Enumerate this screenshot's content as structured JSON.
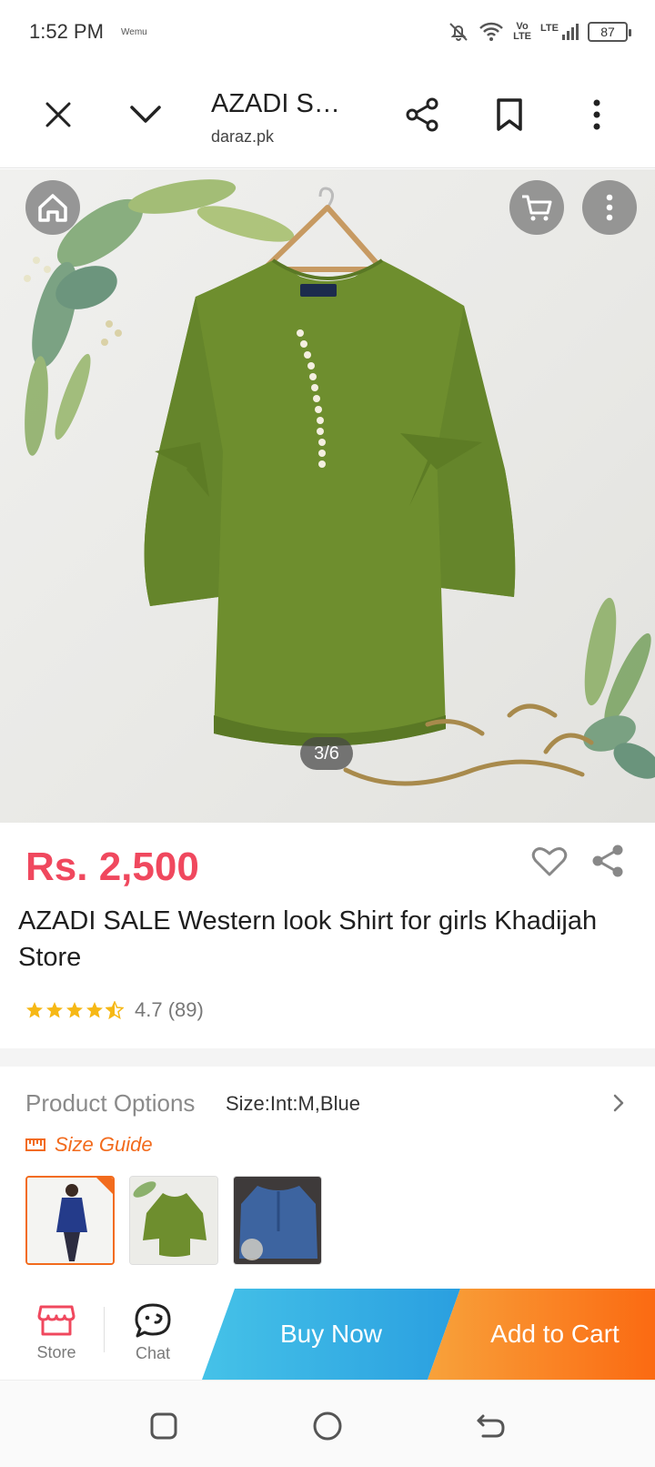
{
  "status_bar": {
    "time": "1:52 PM",
    "small_label": "Wemu",
    "volte": "Vo\nLTE",
    "lte": "LTE",
    "battery": "87"
  },
  "toolbar": {
    "title": "AZADI SALE Western look Shirt for girls Khadijah Store",
    "url": "daraz.pk",
    "icons": [
      "close-icon",
      "chevron-down-icon",
      "share-icon",
      "bookmark-icon",
      "more-vert-icon"
    ]
  },
  "gallery": {
    "counter": "3/6",
    "current": 3,
    "total": 6,
    "icons": [
      "home-icon",
      "cart-icon",
      "more-vert-icon"
    ]
  },
  "product": {
    "price": "Rs. 2,500",
    "title": "AZADI SALE Western look Shirt for girls Khadijah Store",
    "rating_value": 4.7,
    "rating_text": "4.7 (89)",
    "price_color": "#f0485e"
  },
  "options": {
    "label": "Product Options",
    "value": "Size:Int:M,Blue",
    "size_guide": "Size Guide",
    "accent_color": "#f26b1d",
    "thumbnails": [
      {
        "name": "blue-top-model",
        "selected": true
      },
      {
        "name": "green-shirt",
        "selected": false
      },
      {
        "name": "denim-shirt",
        "selected": false
      }
    ]
  },
  "action_bar": {
    "store": "Store",
    "chat": "Chat",
    "buy_now": "Buy Now",
    "add_to_cart": "Add to Cart"
  }
}
